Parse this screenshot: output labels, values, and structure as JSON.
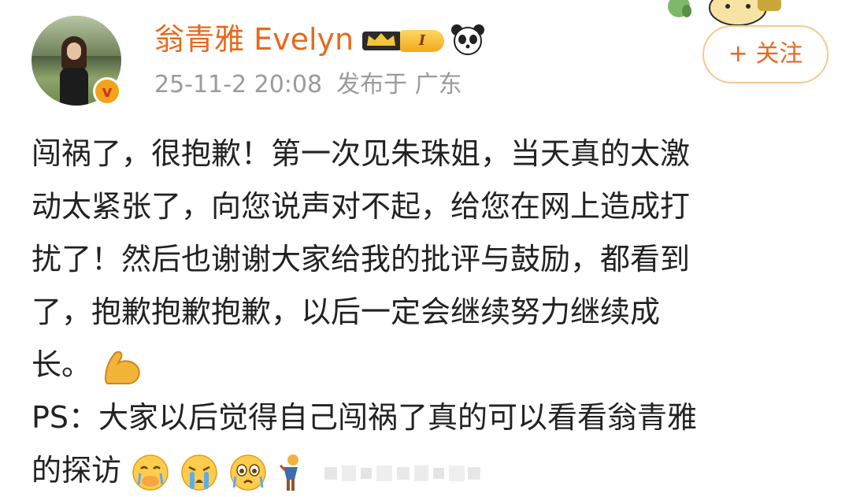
{
  "user": {
    "name": "翁青雅 Evelyn",
    "verified_mark": "v",
    "level_badge": "I",
    "post_time": "25-11-2 20:08",
    "location": "发布于 广东"
  },
  "follow_button": {
    "label": "+ 关注"
  },
  "post": {
    "lines": [
      "闯祸了，很抱歉！第一次见朱珠姐，当天真的太激",
      "动太紧张了，向您说声对不起，给您在网上造成打",
      "扰了！然后也谢谢大家给我的批评与鼓励，都看到",
      "了，抱歉抱歉抱歉，以后一定会继续努力继续成",
      "长。",
      "PS：大家以后觉得自己闯祸了真的可以看看翁青雅",
      "的探访"
    ]
  },
  "icons": {
    "crown": "crown-icon",
    "panda": "panda-icon",
    "muscle": "flexed-biceps-emoji",
    "crying_1": "crying-face-hand-emoji",
    "crying_2": "loudly-crying-emoji",
    "crying_3": "teary-face-emoji",
    "figure": "person-emoji",
    "brand": "#e8691c"
  }
}
